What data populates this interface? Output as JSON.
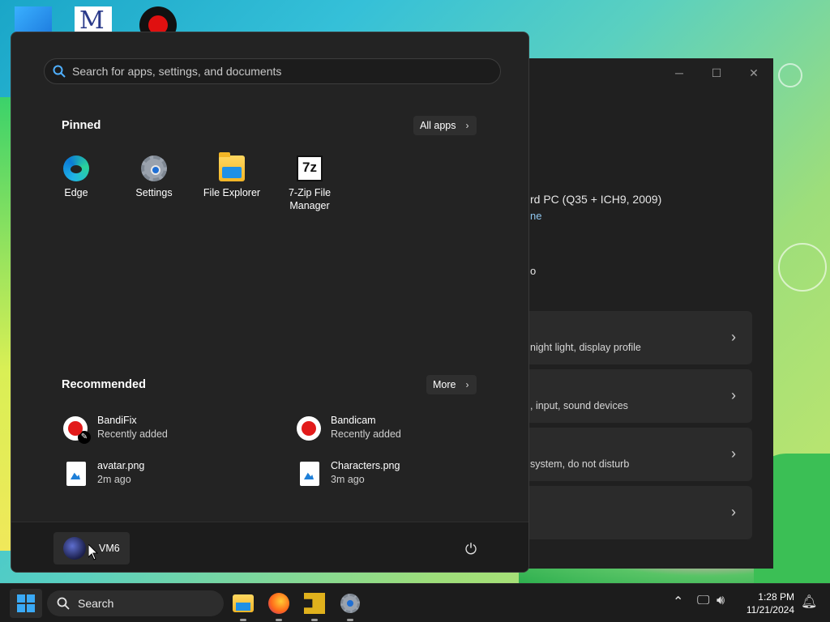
{
  "start_menu": {
    "search_placeholder": "Search for apps, settings, and documents",
    "pinned_title": "Pinned",
    "all_apps_label": "All apps",
    "pinned_apps": [
      {
        "label": "Edge",
        "icon": "edge-icon"
      },
      {
        "label": "Settings",
        "icon": "settings-gear-icon"
      },
      {
        "label": "File Explorer",
        "icon": "folder-icon"
      },
      {
        "label": "7-Zip File Manager",
        "icon": "7zip-icon"
      }
    ],
    "recommended_title": "Recommended",
    "more_label": "More",
    "recommended": [
      {
        "name": "BandiFix",
        "sub": "Recently added",
        "icon": "bandifix-icon"
      },
      {
        "name": "Bandicam",
        "sub": "Recently added",
        "icon": "bandicam-icon"
      },
      {
        "name": "avatar.png",
        "sub": "2m ago",
        "icon": "image-file-icon"
      },
      {
        "name": "Characters.png",
        "sub": "3m ago",
        "icon": "image-file-icon"
      }
    ],
    "user_name": "VM6"
  },
  "settings_window": {
    "device_text": "rd PC (Q35 + ICH9, 2009)",
    "rename_text": "ne",
    "extra_text": "o",
    "cards": [
      {
        "desc": "night light, display profile"
      },
      {
        "desc": ", input, sound devices"
      },
      {
        "desc": "system, do not disturb"
      },
      {
        "desc": ""
      }
    ]
  },
  "taskbar": {
    "search_label": "Search",
    "time": "1:28 PM",
    "date": "11/21/2024"
  },
  "colors": {
    "accent": "#3aa9f5",
    "menu_bg": "#232323",
    "taskbar_bg": "#1c1c1c"
  }
}
